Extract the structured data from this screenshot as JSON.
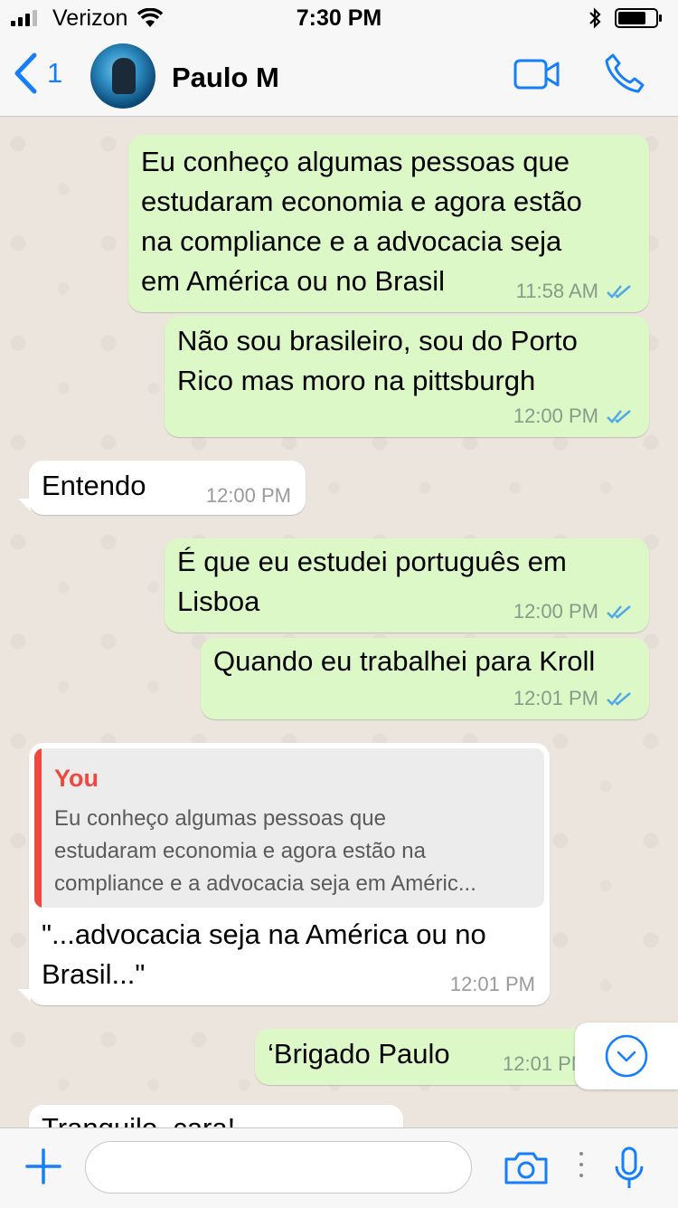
{
  "status_bar": {
    "carrier": "Verizon",
    "time": "7:30 PM"
  },
  "header": {
    "back_count": "1",
    "contact_name": "Paulo M"
  },
  "messages": [
    {
      "direction": "outgoing",
      "lines": [
        "Eu conheço algumas pessoas que",
        "estudaram economia e agora estão",
        "na compliance e a advocacia seja",
        "em América ou no Brasil"
      ],
      "time": "11:58 AM",
      "read": true
    },
    {
      "direction": "outgoing",
      "lines": [
        "Não sou brasileiro, sou do Porto",
        "Rico mas moro na pittsburgh"
      ],
      "time": "12:00 PM",
      "read": true
    },
    {
      "direction": "incoming",
      "lines": [
        "Entendo"
      ],
      "time": "12:00 PM"
    },
    {
      "direction": "outgoing",
      "lines": [
        "É que eu estudei português em",
        "Lisboa"
      ],
      "time": "12:00 PM",
      "read": true
    },
    {
      "direction": "outgoing",
      "lines": [
        "Quando eu trabalhei para Kroll"
      ],
      "time": "12:01 PM",
      "read": true
    },
    {
      "direction": "incoming",
      "quote": {
        "author": "You",
        "lines": [
          "Eu conheço algumas pessoas que",
          "estudaram economia e agora estão na",
          "compliance e a advocacia seja em Améric..."
        ]
      },
      "lines": [
        "\"...advocacia seja na América ou no",
        "Brasil...\""
      ],
      "time": "12:01 PM"
    },
    {
      "direction": "outgoing",
      "lines": [
        "‘Brigado Paulo"
      ],
      "time": "12:01 PM"
    },
    {
      "direction": "incoming",
      "lines": [
        "Tranquilo, cara!"
      ]
    }
  ],
  "input": {
    "placeholder": "",
    "value": ""
  },
  "colors": {
    "accent": "#147efb",
    "outgoing_bubble": "#dcf8c6",
    "incoming_bubble": "#ffffff",
    "chat_background": "#ece5dd",
    "quote_author": "#f0483e",
    "read_ticks": "#4fa8e8"
  },
  "icons": [
    "signal-icon",
    "wifi-icon",
    "bluetooth-icon",
    "battery-icon",
    "back-chevron-icon",
    "video-call-icon",
    "phone-call-icon",
    "double-check-icon",
    "scroll-down-icon",
    "plus-icon",
    "camera-icon",
    "microphone-icon"
  ]
}
